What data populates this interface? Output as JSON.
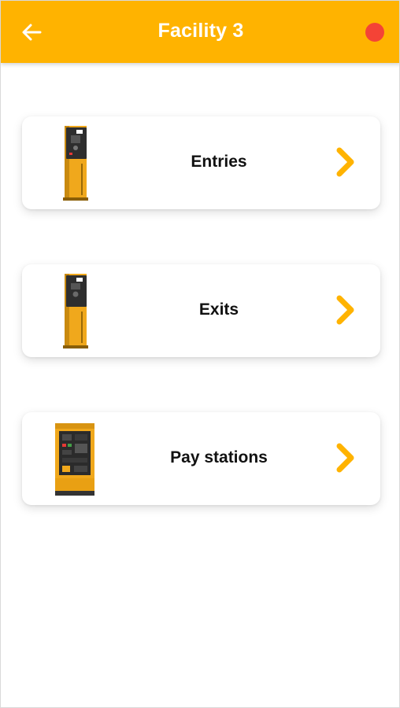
{
  "app_bar": {
    "title": "Facility 3",
    "back_icon": "arrow-left-icon",
    "status_dot_color": "#f44336",
    "background_color": "#ffb300"
  },
  "cards": [
    {
      "label": "Entries",
      "image": "entry-terminal",
      "chevron_icon": "chevron-right-icon"
    },
    {
      "label": "Exits",
      "image": "exit-terminal",
      "chevron_icon": "chevron-right-icon"
    },
    {
      "label": "Pay stations",
      "image": "pay-station",
      "chevron_icon": "chevron-right-icon"
    }
  ],
  "accent_color": "#ffb300"
}
